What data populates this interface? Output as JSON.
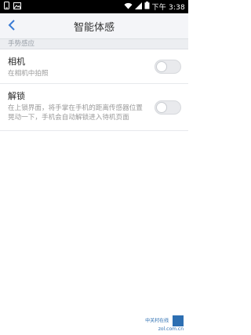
{
  "status_bar": {
    "time": "下午 3:38",
    "icons": [
      "phone-icon",
      "image-icon",
      "wifi-icon",
      "signal-icon",
      "battery-icon"
    ]
  },
  "app_bar": {
    "title": "智能体感",
    "back_icon": "chevron-left-icon"
  },
  "section": {
    "header": "手势感应"
  },
  "settings": [
    {
      "title": "相机",
      "description": "在相机中拍照",
      "enabled": false
    },
    {
      "title": "解锁",
      "description": "在上锁界面，将手掌在手机的距离传感器位置晃动一下，手机会自动解锁进入待机页面",
      "enabled": false
    }
  ],
  "watermark": {
    "line1": "中关村在线",
    "line2": "zol.com.cn"
  },
  "colors": {
    "status_bar": "#000000",
    "app_bar": "#f4f5f8",
    "section_header_bg": "#eceef1",
    "toggle_off": "#e9eaed",
    "watermark": "#2d6fb2"
  }
}
